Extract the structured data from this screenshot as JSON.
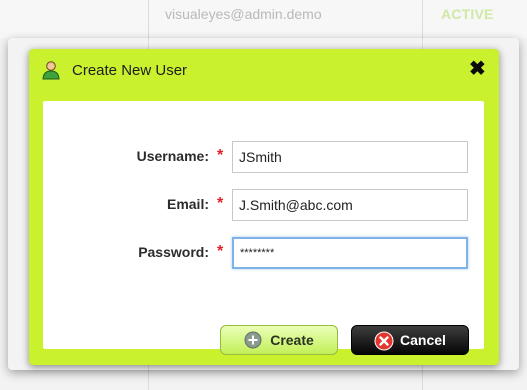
{
  "background": {
    "email": "visualeyes@admin.demo",
    "status": "ACTIVE"
  },
  "dialog": {
    "title": "Create New User",
    "close_label": "✖",
    "required_marker": "*",
    "fields": {
      "username": {
        "label": "Username:",
        "value": "JSmith"
      },
      "email": {
        "label": "Email:",
        "value": "J.Smith@abc.com"
      },
      "password": {
        "label": "Password:",
        "value": "********"
      }
    },
    "buttons": {
      "create": "Create",
      "cancel": "Cancel"
    }
  },
  "colors": {
    "accent": "#c9f12e",
    "required": "#e0202a",
    "cancel": "#050505"
  },
  "icons": {
    "title": "user-icon",
    "close": "close-icon",
    "create": "plus-circle-icon",
    "cancel": "x-circle-icon"
  }
}
